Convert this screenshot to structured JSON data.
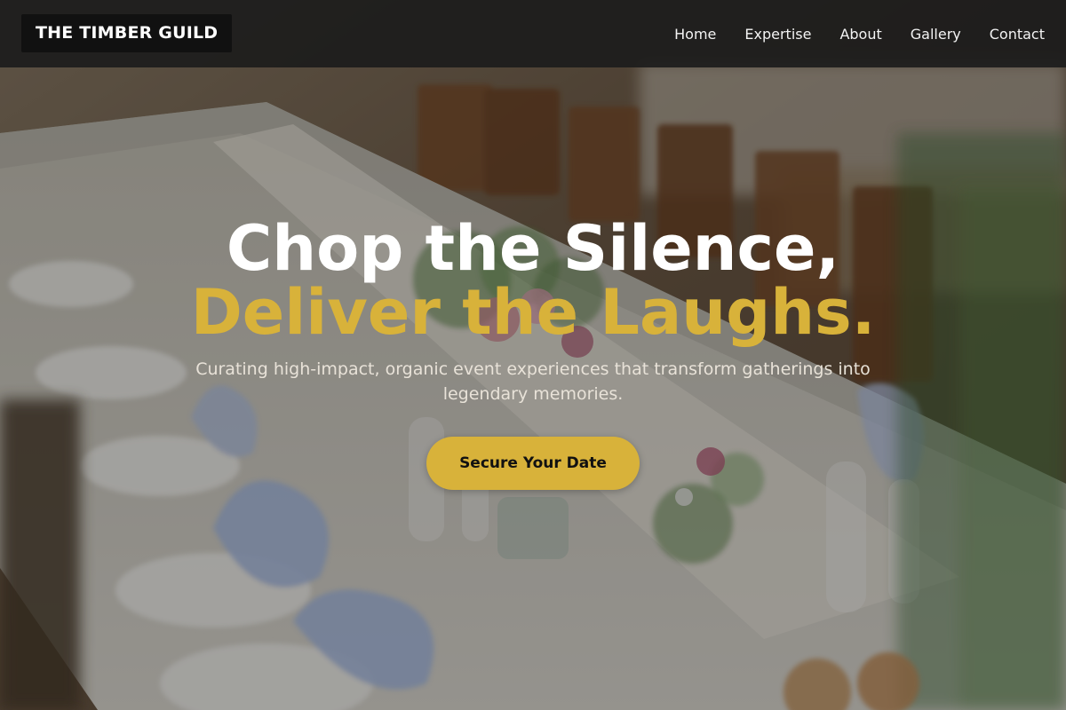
{
  "brand": {
    "name": "THE TIMBER GUILD"
  },
  "nav": {
    "items": [
      {
        "label": "Home"
      },
      {
        "label": "Expertise"
      },
      {
        "label": "About"
      },
      {
        "label": "Gallery"
      },
      {
        "label": "Contact"
      }
    ]
  },
  "hero": {
    "headline_line_1": "Chop the Silence,",
    "headline_line_2": "Deliver the Laughs.",
    "subheadline": "Curating high-impact, organic event experiences that transform gatherings into legendary memories.",
    "cta_label": "Secure Your Date",
    "background_image": "event-table-setting-photo"
  },
  "colors": {
    "accent": "#d8b23a",
    "navbar": "#1c1c1c",
    "brand_box": "#111111",
    "headline_primary": "#ffffff"
  }
}
